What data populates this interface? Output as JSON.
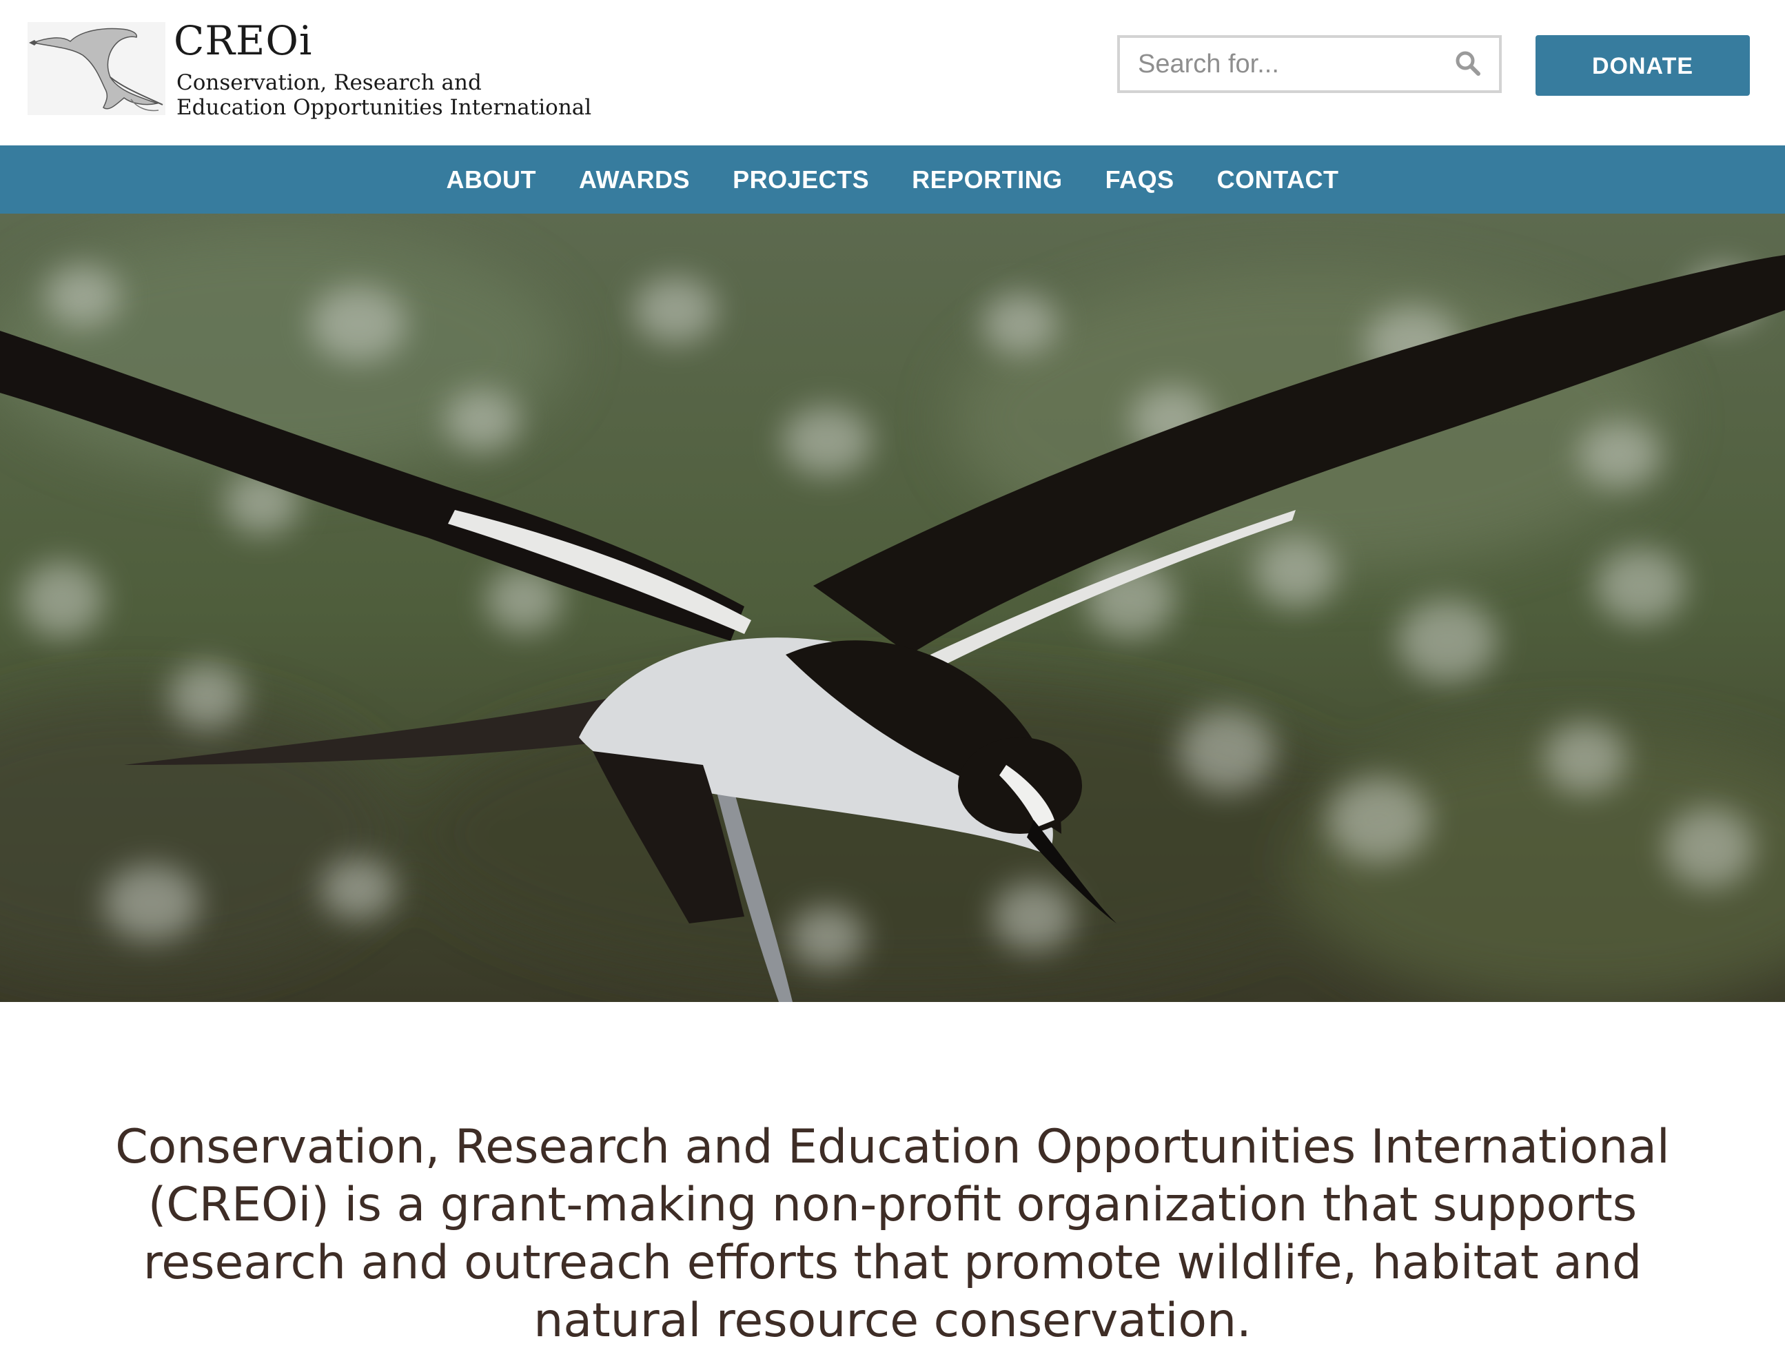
{
  "header": {
    "logo": {
      "abbr": "CREOi",
      "line1": "Conservation, Research and",
      "line2": "Education Opportunities International"
    },
    "search": {
      "placeholder": "Search for...",
      "icon": "search-icon"
    },
    "donate_label": "DONATE"
  },
  "nav": {
    "items": [
      {
        "label": "ABOUT"
      },
      {
        "label": "AWARDS"
      },
      {
        "label": "PROJECTS"
      },
      {
        "label": "REPORTING"
      },
      {
        "label": "FAQS"
      },
      {
        "label": "CONTACT"
      }
    ]
  },
  "intro": {
    "text": "Conservation, Research and Education Opportunities International (CREOi) is a grant-making non-profit organization that supports research and outreach efforts that promote wildlife, habitat and natural resource conservation."
  },
  "colors": {
    "accent": "#377c9e",
    "intro_text": "#3e2d26"
  }
}
